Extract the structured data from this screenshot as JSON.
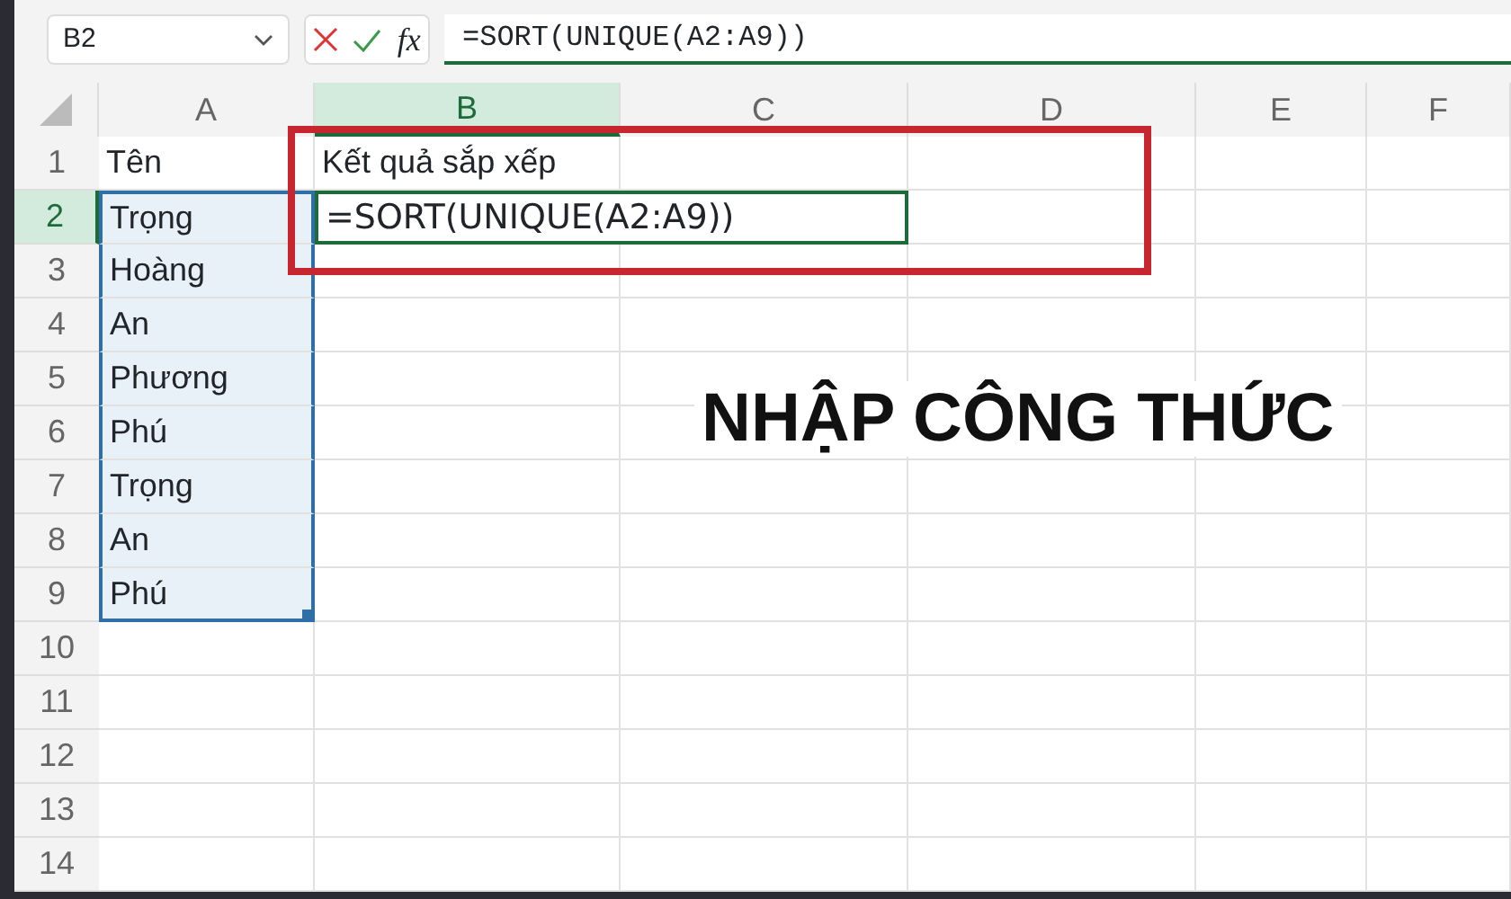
{
  "name_box": {
    "value": "B2"
  },
  "formula_bar": {
    "function_label": "fx",
    "value": "=SORT(UNIQUE(A2:A9))"
  },
  "columns": [
    {
      "label": "A",
      "selected": false
    },
    {
      "label": "B",
      "selected": true
    },
    {
      "label": "C",
      "selected": false
    },
    {
      "label": "D",
      "selected": false
    },
    {
      "label": "E",
      "selected": false
    },
    {
      "label": "F",
      "selected": false
    }
  ],
  "rows": [
    {
      "number": "1",
      "selected": false,
      "cells": [
        {
          "text": "Tên",
          "highlighted": false,
          "active": false
        },
        {
          "text": "Kết quả sắp xếp",
          "highlighted": false,
          "active": false
        }
      ]
    },
    {
      "number": "2",
      "selected": true,
      "cells": [
        {
          "text": "Trọng",
          "highlighted": true,
          "active": false
        },
        {
          "text": "=SORT(UNIQUE(A2:A9))",
          "highlighted": false,
          "active": true
        }
      ]
    },
    {
      "number": "3",
      "selected": false,
      "cells": [
        {
          "text": "Hoàng",
          "highlighted": true,
          "active": false
        }
      ]
    },
    {
      "number": "4",
      "selected": false,
      "cells": [
        {
          "text": "An",
          "highlighted": true,
          "active": false
        }
      ]
    },
    {
      "number": "5",
      "selected": false,
      "cells": [
        {
          "text": "Phương",
          "highlighted": true,
          "active": false
        }
      ]
    },
    {
      "number": "6",
      "selected": false,
      "cells": [
        {
          "text": "Phú",
          "highlighted": true,
          "active": false
        }
      ]
    },
    {
      "number": "7",
      "selected": false,
      "cells": [
        {
          "text": "Trọng",
          "highlighted": true,
          "active": false
        }
      ]
    },
    {
      "number": "8",
      "selected": false,
      "cells": [
        {
          "text": "An",
          "highlighted": true,
          "active": false
        }
      ]
    },
    {
      "number": "9",
      "selected": false,
      "cells": [
        {
          "text": "Phú",
          "highlighted": true,
          "active": false
        }
      ]
    },
    {
      "number": "10",
      "selected": false,
      "cells": []
    },
    {
      "number": "11",
      "selected": false,
      "cells": []
    },
    {
      "number": "12",
      "selected": false,
      "cells": []
    },
    {
      "number": "13",
      "selected": false,
      "cells": []
    },
    {
      "number": "14",
      "selected": false,
      "cells": []
    }
  ],
  "annotation": {
    "callout_text": "NHẬP CÔNG THỨC"
  }
}
